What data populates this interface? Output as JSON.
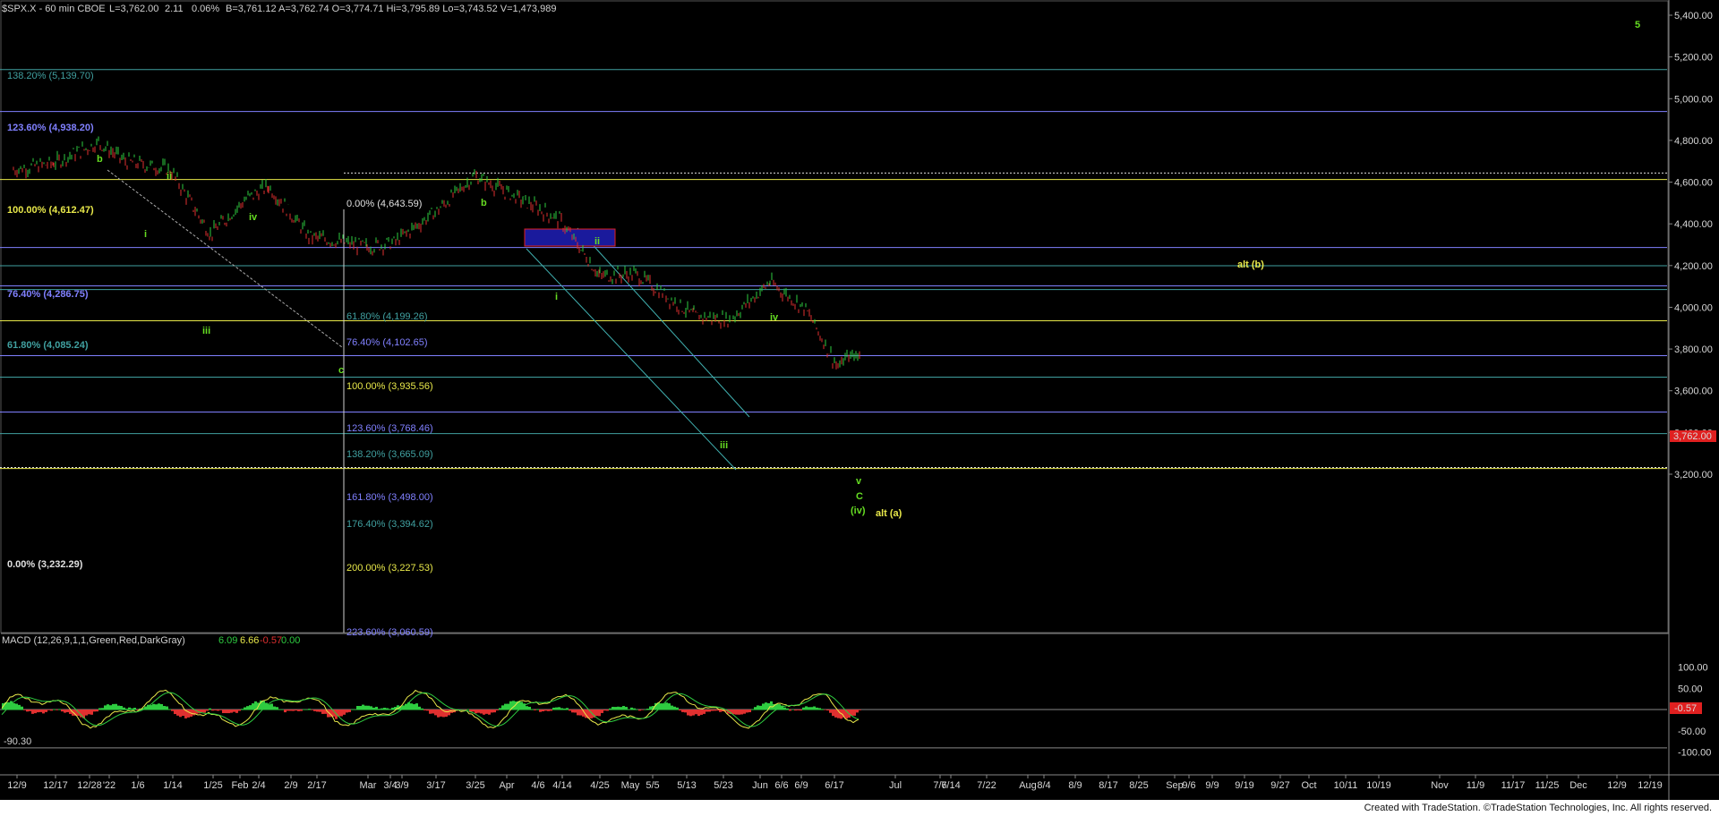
{
  "header": {
    "symbol": "$SPX.X - 60 min  CBOE",
    "last": "L=3,762.00",
    "change": "2.11",
    "change_pct": "0.06%",
    "quote": "B=3,761.12  A=3,762.74  O=3,774.71  Hi=3,795.89  Lo=3,743.52  V=1,473,989"
  },
  "colors": {
    "background": "#000000",
    "up_bar": "#2ecc40",
    "down_bar": "#e03030",
    "blue_fib": "#8080ff",
    "teal_fib": "#40a0a0",
    "yellow_fib": "#e8e84a",
    "white_fib": "#e0e0e0",
    "wave_green": "#66dd22",
    "wave_yellow": "#e8e84a",
    "price_box": "#e02020"
  },
  "price_axis": {
    "ticks": [
      "5,400.00",
      "5,200.00",
      "5,000.00",
      "4,800.00",
      "4,600.00",
      "4,400.00",
      "4,200.00",
      "4,000.00",
      "3,800.00",
      "3,600.00",
      "3,400.00",
      "3,200.00"
    ],
    "last_price_label": "3,762.00"
  },
  "macd_axis": {
    "ticks": [
      "100.00",
      "50.00",
      "-50.00",
      "-100.00"
    ],
    "last_label": "-0.57",
    "low_label": "-90.30"
  },
  "macd_header": {
    "name": "MACD (12,26,9,1,1,Green,Red,DarkGray)",
    "v1": "6.09",
    "v2": "6.66",
    "v3": "-0.57",
    "v4": "0.00"
  },
  "date_axis": [
    "12/9",
    "12/17",
    "12/28",
    "'22",
    "1/6",
    "1/14",
    "1/25",
    "Feb",
    "2/4",
    "2/9",
    "2/17",
    "Mar",
    "3/4",
    "3/9",
    "3/17",
    "3/25",
    "Apr",
    "4/6",
    "4/14",
    "4/25",
    "May",
    "5/5",
    "5/13",
    "5/23",
    "Jun",
    "6/6",
    "6/9",
    "6/17",
    "Jul",
    "7/6",
    "7/14",
    "7/22",
    "Aug",
    "8/4",
    "8/9",
    "8/17",
    "8/25",
    "Sep",
    "9/6",
    "9/9",
    "9/19",
    "9/27",
    "Oct",
    "10/11",
    "10/19",
    "Nov",
    "11/9",
    "11/17",
    "11/25",
    "Dec",
    "12/9",
    "12/19"
  ],
  "fib_labels": {
    "f138": "138.20% (5,139.70)",
    "f123": "123.60% (4,938.20)",
    "f100": "100.00% (4,612.47)",
    "f764": "76.40% (4,286.75)",
    "f618": "61.80% (4,085.24)",
    "f0low": "0.00% (3,232.29)",
    "g0": "0.00% (4,643.59)",
    "g618": "61.80% (4,199.26)",
    "g764": "76.40% (4,102.65)",
    "g100": "100.00% (3,935.56)",
    "g1236": "123.60% (3,768.46)",
    "g1382": "138.20% (3,665.09)",
    "g1618": "161.80% (3,498.00)",
    "g1764": "176.40% (3,394.62)",
    "g200": "200.00% (3,227.53)",
    "g2236": "223.60% (3,060.59)"
  },
  "wave_labels": {
    "b1": "b",
    "i1": "i",
    "ii1": "ii",
    "iii1": "iii",
    "iv1": "iv",
    "c1": "c",
    "b2": "b",
    "i2": "i",
    "ii2": "ii",
    "iii2": "iii",
    "iv2": "iv",
    "v2": "v",
    "C2": "C",
    "iv_paren": "(iv)",
    "alt_a": "alt (a)",
    "alt_b": "alt (b)",
    "five": "5"
  },
  "footer": "Created with TradeStation. ©TradeStation Technologies, Inc. All rights reserved.",
  "chart_data": {
    "type": "line",
    "title": "$SPX.X - 60 min",
    "x": [
      "12/9",
      "12/17",
      "12/28",
      "1/6",
      "1/14",
      "1/25",
      "2/4",
      "2/9",
      "2/17",
      "3/4",
      "3/9",
      "3/17",
      "3/25",
      "4/6",
      "4/14",
      "4/25",
      "5/5",
      "5/13",
      "5/23",
      "6/6",
      "6/9",
      "6/17"
    ],
    "series": [
      {
        "name": "$SPX.X",
        "values": [
          4660,
          4690,
          4790,
          4700,
          4660,
          4350,
          4520,
          4580,
          4340,
          4290,
          4310,
          4470,
          4630,
          4510,
          4420,
          4150,
          4160,
          3960,
          3940,
          4120,
          3990,
          3680
        ]
      }
    ],
    "ylim": [
      3060,
      5420
    ],
    "grid": false,
    "fib_levels": [
      5139.7,
      4938.2,
      4643.59,
      4612.47,
      4286.75,
      4199.26,
      4102.65,
      4085.24,
      3935.56,
      3768.46,
      3665.09,
      3498.0,
      3394.62,
      3232.29,
      3227.53
    ],
    "macd": {
      "ylim": [
        -110,
        115
      ],
      "last": -0.57,
      "min_label": -90.3
    }
  }
}
